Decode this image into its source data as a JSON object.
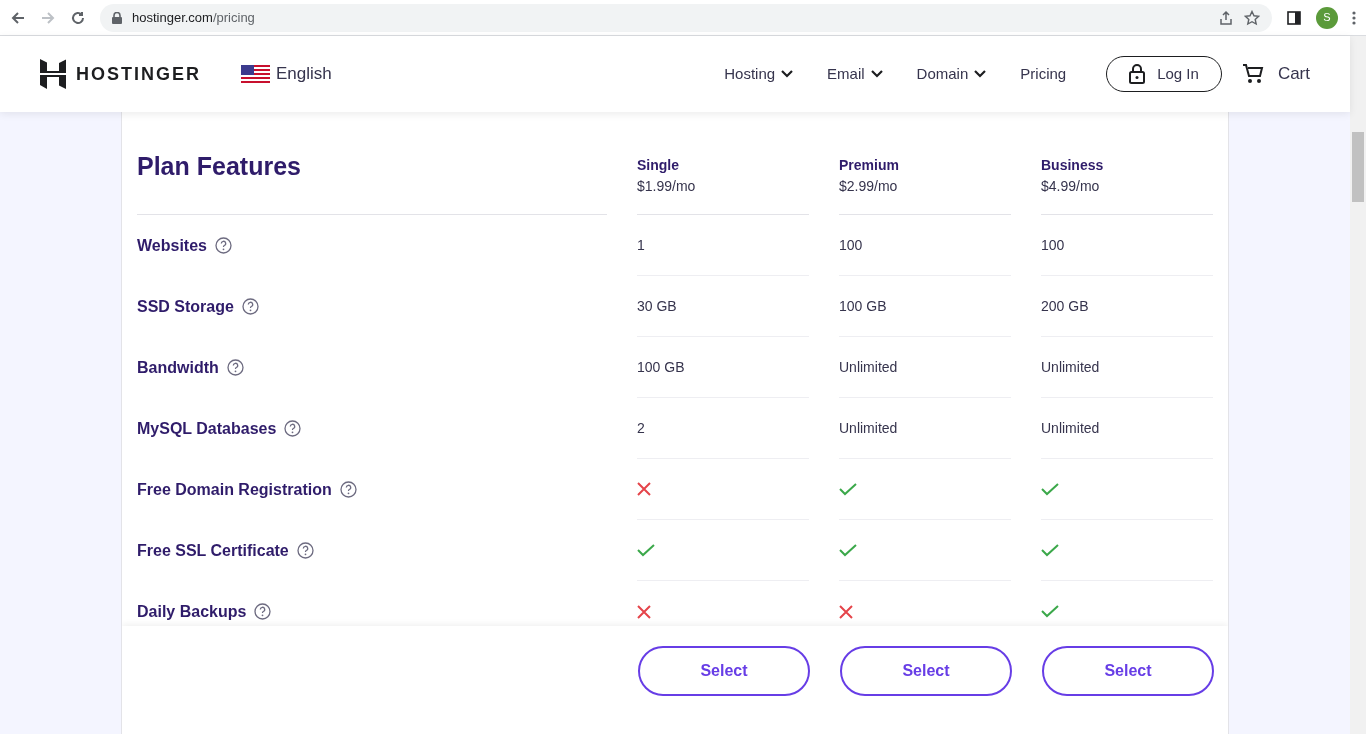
{
  "browser": {
    "url_host": "hostinger.com",
    "url_path": "/pricing",
    "profile_initial": "S"
  },
  "header": {
    "brand": "HOSTINGER",
    "language": "English",
    "nav": [
      {
        "label": "Hosting",
        "dropdown": true
      },
      {
        "label": "Email",
        "dropdown": true
      },
      {
        "label": "Domain",
        "dropdown": true
      },
      {
        "label": "Pricing",
        "dropdown": false
      }
    ],
    "login": "Log In",
    "cart": "Cart"
  },
  "table": {
    "title": "Plan Features",
    "plans": [
      {
        "name": "Single",
        "price": "$1.99/mo"
      },
      {
        "name": "Premium",
        "price": "$2.99/mo"
      },
      {
        "name": "Business",
        "price": "$4.99/mo"
      }
    ],
    "rows": [
      {
        "feature": "Websites",
        "cells": [
          {
            "kind": "text",
            "value": "1"
          },
          {
            "kind": "text",
            "value": "100"
          },
          {
            "kind": "text",
            "value": "100"
          }
        ]
      },
      {
        "feature": "SSD Storage",
        "cells": [
          {
            "kind": "text",
            "value": "30 GB"
          },
          {
            "kind": "text",
            "value": "100 GB"
          },
          {
            "kind": "text",
            "value": "200 GB"
          }
        ]
      },
      {
        "feature": "Bandwidth",
        "cells": [
          {
            "kind": "text",
            "value": "100 GB"
          },
          {
            "kind": "text",
            "value": "Unlimited"
          },
          {
            "kind": "text",
            "value": "Unlimited"
          }
        ]
      },
      {
        "feature": "MySQL Databases",
        "cells": [
          {
            "kind": "text",
            "value": "2"
          },
          {
            "kind": "text",
            "value": "Unlimited"
          },
          {
            "kind": "text",
            "value": "Unlimited"
          }
        ]
      },
      {
        "feature": "Free Domain Registration",
        "cells": [
          {
            "kind": "cross"
          },
          {
            "kind": "check"
          },
          {
            "kind": "check"
          }
        ]
      },
      {
        "feature": "Free SSL Certificate",
        "cells": [
          {
            "kind": "check"
          },
          {
            "kind": "check"
          },
          {
            "kind": "check"
          }
        ]
      },
      {
        "feature": "Daily Backups",
        "cells": [
          {
            "kind": "cross"
          },
          {
            "kind": "cross"
          },
          {
            "kind": "check"
          }
        ]
      }
    ],
    "buttons": [
      "Select",
      "Select",
      "Select"
    ]
  }
}
